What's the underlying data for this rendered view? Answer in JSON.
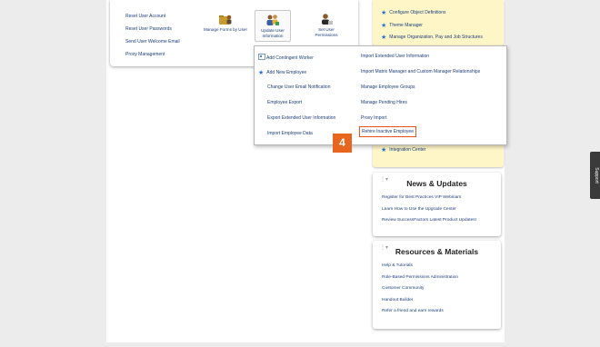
{
  "left_links": [
    "Reset User Account",
    "Reset User Passwords",
    "Send User Welcome Email",
    "Proxy Management"
  ],
  "tiles": [
    {
      "label": "Manage Forms by User",
      "icon": "folder-user-icon"
    },
    {
      "label": "Update User Information",
      "icon": "users-update-icon"
    },
    {
      "label": "Set User Permissions",
      "icon": "user-permissions-icon"
    }
  ],
  "yellow_top_links": [
    "Configure Object Definitions",
    "Theme Manager",
    "Manage Organization, Pay and Job Structures"
  ],
  "dropdown": {
    "left": [
      "Add Contingent Worker",
      "Add New Employee",
      "Change User Email Notification",
      "Employee Export",
      "Export Extended User Information",
      "Import Employee Data"
    ],
    "right": [
      "Import Extended User Information",
      "Import Matrix Manager and Custom Manager Relationships",
      "Manage Employee Groups",
      "Manage Pending Hires",
      "Proxy Import",
      "Rehire Inactive Employee"
    ]
  },
  "step_badge": "4",
  "yellow_bottom_link": "Integration Center",
  "news": {
    "title": "News & Updates",
    "links": [
      "Register for Best Practices VIP Webinars",
      "Learn How to Use the Upgrade Center",
      "Review SuccessFactors Latest Product Updates!"
    ]
  },
  "resources": {
    "title": "Resources & Materials",
    "links": [
      "Help & Tutorials",
      "Role-Based Permissions Administration",
      "Customer Community",
      "Handout Builder",
      "Refer a friend and earn rewards"
    ]
  },
  "support_label": "Support",
  "colors": {
    "link": "#1a3e7a",
    "accent_orange": "#e8651e",
    "highlight_border": "#e8531e",
    "tips_background": "#fff6c8",
    "star_blue": "#2c6fd1"
  }
}
